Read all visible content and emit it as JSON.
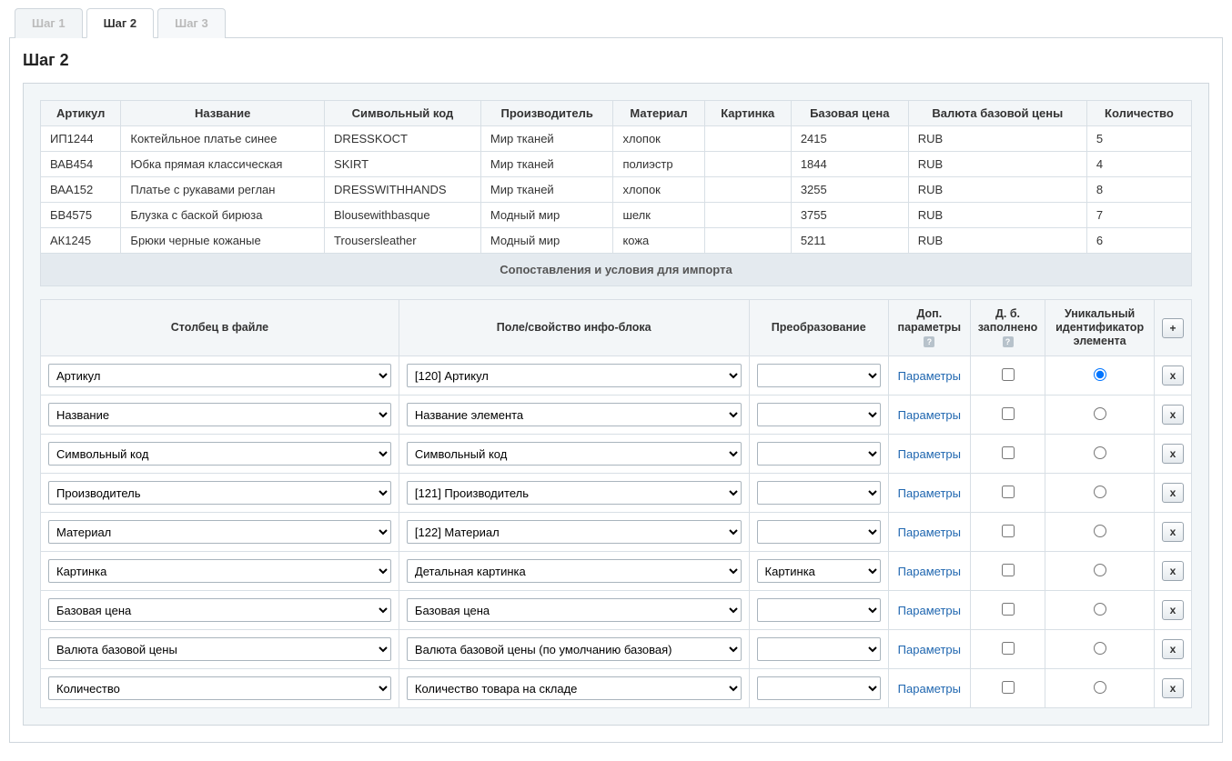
{
  "tabs": [
    {
      "label": "Шаг 1",
      "state": "inactive"
    },
    {
      "label": "Шаг 2",
      "state": "active"
    },
    {
      "label": "Шаг 3",
      "state": "disabled"
    }
  ],
  "title": "Шаг 2",
  "preview": {
    "headers": [
      "Артикул",
      "Название",
      "Символьный код",
      "Производитель",
      "Материал",
      "Картинка",
      "Базовая цена",
      "Валюта базовой цены",
      "Количество"
    ],
    "rows": [
      [
        "ИП1244",
        "Коктейльное платье синее",
        "DRESSKOCT",
        "Мир тканей",
        "хлопок",
        "",
        "2415",
        "RUB",
        "5"
      ],
      [
        "ВАВ454",
        "Юбка прямая классическая",
        "SKIRT",
        "Мир тканей",
        "полиэстр",
        "",
        "1844",
        "RUB",
        "4"
      ],
      [
        "ВАА152",
        "Платье с рукавами реглан",
        "DRESSWITHHANDS",
        "Мир тканей",
        "хлопок",
        "",
        "3255",
        "RUB",
        "8"
      ],
      [
        "БВ4575",
        "Блузка с баской бирюза",
        "Blousewithbasque",
        "Модный мир",
        "шелк",
        "",
        "3755",
        "RUB",
        "7"
      ],
      [
        "АК1245",
        "Брюки черные кожаные",
        "Trousersleather",
        "Модный мир",
        "кожа",
        "",
        "5211",
        "RUB",
        "6"
      ]
    ]
  },
  "mapping_section_title": "Сопоставления и условия для импорта",
  "mapping_headers": {
    "file_col": "Столбец в файле",
    "field": "Поле/свойство инфо-блока",
    "transform": "Преобразование",
    "extra_params": "Доп. параметры",
    "must_fill": "Д. б. заполнено",
    "uid": "Уникальный идентификатор элемента",
    "add": "+"
  },
  "help_glyph": "?",
  "param_link_label": "Параметры",
  "delete_label": "x",
  "mapping_rows": [
    {
      "file": "Артикул",
      "field": "[120] Артикул",
      "transform": "",
      "uid": true
    },
    {
      "file": "Название",
      "field": "Название элемента",
      "transform": "",
      "uid": false
    },
    {
      "file": "Символьный код",
      "field": "Символьный код",
      "transform": "",
      "uid": false
    },
    {
      "file": "Производитель",
      "field": "[121] Производитель",
      "transform": "",
      "uid": false
    },
    {
      "file": "Материал",
      "field": "[122] Материал",
      "transform": "",
      "uid": false
    },
    {
      "file": "Картинка",
      "field": "Детальная картинка",
      "transform": "Картинка",
      "uid": false
    },
    {
      "file": "Базовая цена",
      "field": "Базовая цена",
      "transform": "",
      "uid": false
    },
    {
      "file": "Валюта базовой цены",
      "field": "Валюта базовой цены (по умолчанию базовая)",
      "transform": "",
      "uid": false
    },
    {
      "file": "Количество",
      "field": "Количество товара на складе",
      "transform": "",
      "uid": false
    }
  ]
}
